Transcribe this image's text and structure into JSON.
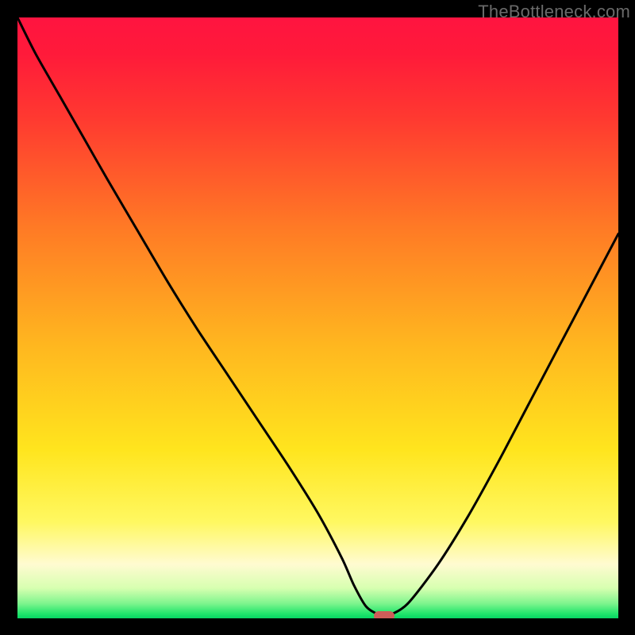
{
  "watermark": "TheBottleneck.com",
  "colors": {
    "curve": "#000000",
    "marker": "#cd5d59"
  },
  "chart_data": {
    "type": "line",
    "title": "",
    "xlabel": "",
    "ylabel": "",
    "xlim": [
      0,
      100
    ],
    "ylim": [
      0,
      100
    ],
    "grid": false,
    "legend": false,
    "x": [
      0,
      3,
      7,
      11,
      15,
      20,
      25,
      30,
      35,
      40,
      45,
      50,
      54,
      56,
      58,
      60,
      62,
      65,
      70,
      75,
      80,
      85,
      90,
      95,
      100
    ],
    "y": [
      100,
      94,
      87,
      80,
      73,
      64.5,
      56,
      48,
      40.5,
      33,
      25.5,
      17.5,
      10,
      5.5,
      2,
      0.7,
      0.6,
      2.5,
      9,
      17,
      26,
      35.5,
      45,
      54.5,
      64
    ],
    "marker": {
      "x": 61,
      "y": 0.4
    },
    "flat_segment": {
      "x_start": 56.5,
      "x_end": 63.2,
      "y": 0.6
    }
  }
}
